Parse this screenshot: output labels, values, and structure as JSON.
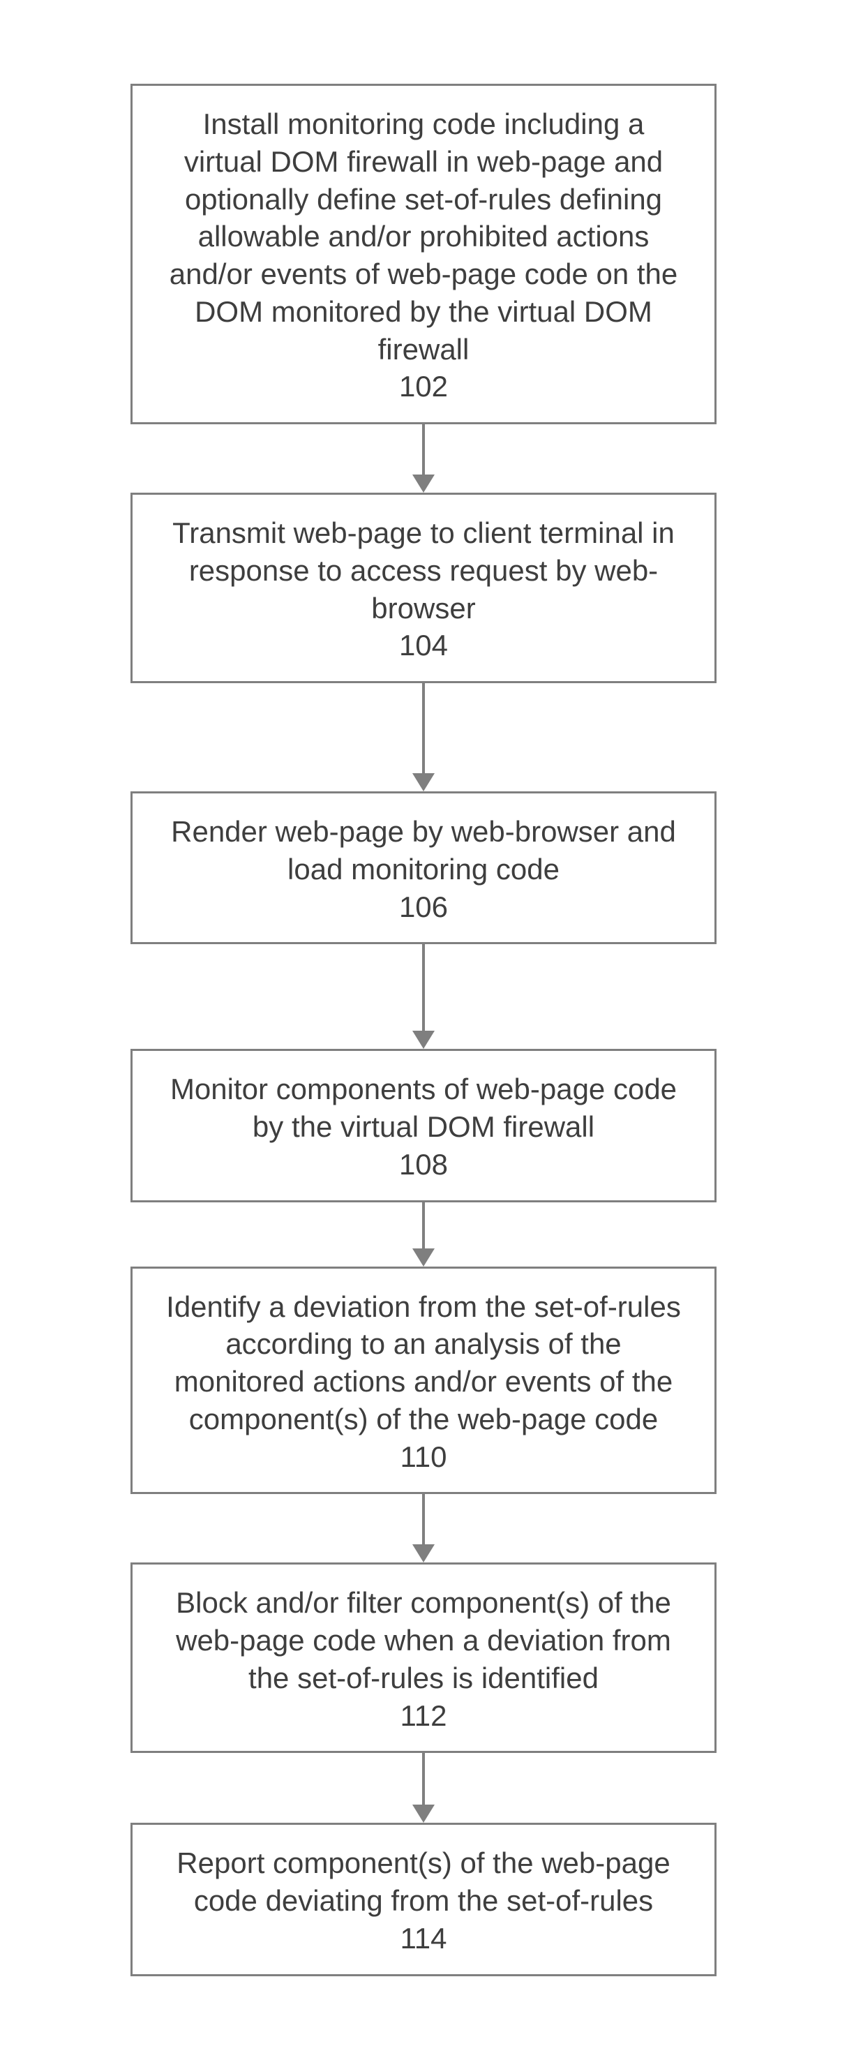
{
  "steps": [
    {
      "text": "Install monitoring code including a virtual DOM firewall in web-page and optionally define set-of-rules defining allowable and/or prohibited actions and/or events of web-page code on the DOM monitored by the virtual DOM firewall",
      "num": "102",
      "gap": 98
    },
    {
      "text": "Transmit web-page to client terminal in response to access request by web-browser",
      "num": "104",
      "gap": 155
    },
    {
      "text": "Render web-page by web-browser and load monitoring code",
      "num": "106",
      "gap": 150
    },
    {
      "text": "Monitor components of web-page code by the virtual DOM firewall",
      "num": "108",
      "gap": 92
    },
    {
      "text": "Identify a deviation from the set-of-rules according to an analysis of the monitored actions and/or events of the component(s) of the web-page code",
      "num": "110",
      "gap": 98
    },
    {
      "text": "Block and/or filter component(s) of the web-page code when a deviation from the set-of-rules is identified",
      "num": "112",
      "gap": 100
    },
    {
      "text": "Report component(s) of the web-page code deviating from the set-of-rules",
      "num": "114",
      "gap": 0
    }
  ]
}
